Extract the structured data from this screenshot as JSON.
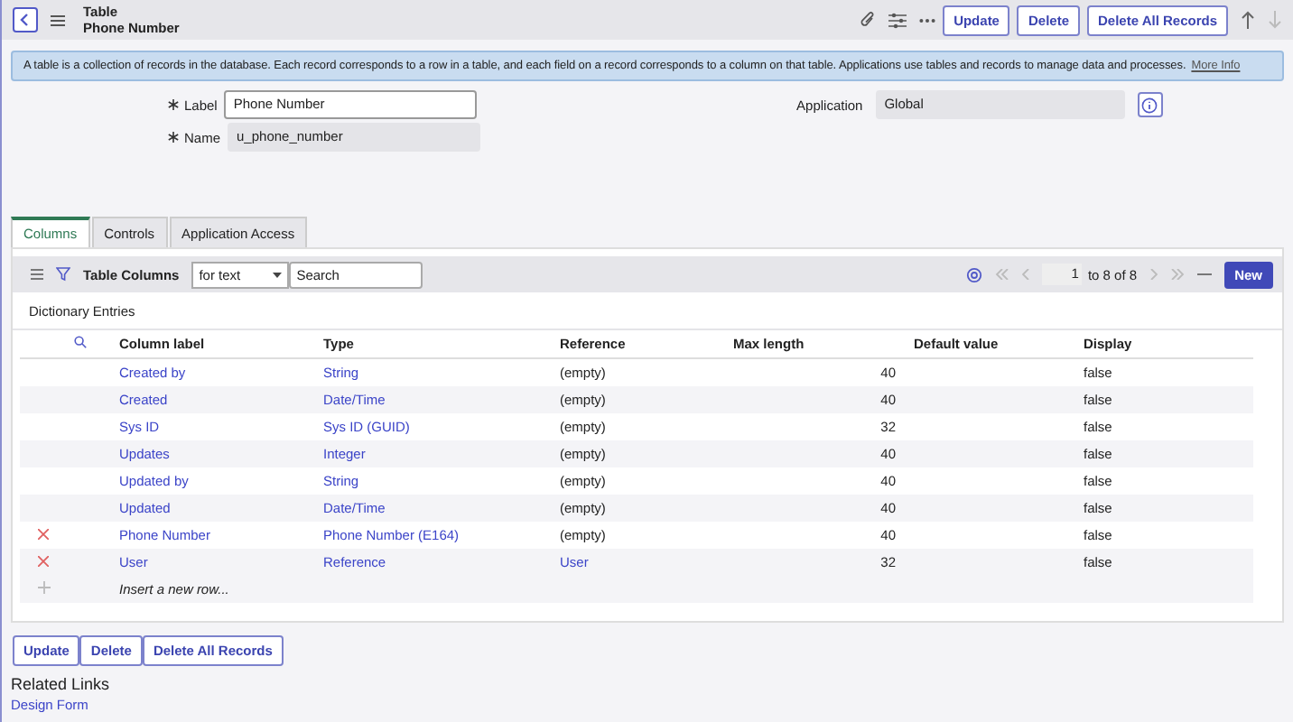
{
  "header": {
    "title": "Table",
    "subtitle": "Phone Number",
    "buttons": [
      "Update",
      "Delete",
      "Delete All Records"
    ]
  },
  "info": {
    "text": "A table is a collection of records in the database. Each record corresponds to a row in a table, and each field on a record corresponds to a column on that table. Applications use tables and records to manage data and processes.",
    "link": "More Info"
  },
  "form": {
    "label": {
      "label": "Label",
      "value": "Phone Number",
      "required": true,
      "readonly": false
    },
    "name": {
      "label": "Name",
      "value": "u_phone_number",
      "required": true,
      "readonly": true
    },
    "application": {
      "label": "Application",
      "value": "Global"
    }
  },
  "tabs": [
    {
      "label": "Columns",
      "selected": true
    },
    {
      "label": "Controls",
      "selected": false
    },
    {
      "label": "Application Access",
      "selected": false
    }
  ],
  "list": {
    "title": "Table Columns",
    "filter": "for text",
    "search_placeholder": "Search",
    "pagination_current": "1",
    "pagination_text": "to 8 of 8",
    "new_button": "New",
    "caption": "Dictionary Entries",
    "columns": [
      "Column label",
      "Type",
      "Reference",
      "Max length",
      "Default value",
      "Display"
    ],
    "rows": [
      {
        "label": "Created by",
        "type": "String",
        "reference": "(empty)",
        "reference_link": false,
        "max_length": "40",
        "display": "false",
        "deletable": false
      },
      {
        "label": "Created",
        "type": "Date/Time",
        "reference": "(empty)",
        "reference_link": false,
        "max_length": "40",
        "display": "false",
        "deletable": false
      },
      {
        "label": "Sys ID",
        "type": "Sys ID (GUID)",
        "reference": "(empty)",
        "reference_link": false,
        "max_length": "32",
        "display": "false",
        "deletable": false
      },
      {
        "label": "Updates",
        "type": "Integer",
        "reference": "(empty)",
        "reference_link": false,
        "max_length": "40",
        "display": "false",
        "deletable": false
      },
      {
        "label": "Updated by",
        "type": "String",
        "reference": "(empty)",
        "reference_link": false,
        "max_length": "40",
        "display": "false",
        "deletable": false
      },
      {
        "label": "Updated",
        "type": "Date/Time",
        "reference": "(empty)",
        "reference_link": false,
        "max_length": "40",
        "display": "false",
        "deletable": false
      },
      {
        "label": "Phone Number",
        "type": "Phone Number (E164)",
        "reference": "(empty)",
        "reference_link": false,
        "max_length": "40",
        "display": "false",
        "deletable": true
      },
      {
        "label": "User",
        "type": "Reference",
        "reference": "User",
        "reference_link": true,
        "max_length": "32",
        "display": "false",
        "deletable": true
      }
    ],
    "insert_text": "Insert a new row..."
  },
  "bottom_buttons": [
    "Update",
    "Delete",
    "Delete All Records"
  ],
  "related": {
    "title": "Related Links",
    "links": [
      "Design Form"
    ]
  }
}
